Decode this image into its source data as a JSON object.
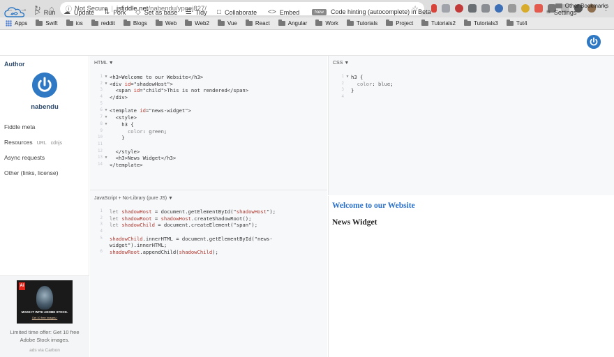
{
  "browser": {
    "security_label": "Not Secure",
    "url_host": "jsfiddle.net",
    "url_path": "/nabendu/ypgej827/",
    "bookmarks": [
      "Apps",
      "Swift",
      "ios",
      "reddit",
      "Blogs",
      "Web",
      "Web2",
      "Vue",
      "React",
      "Angular",
      "Work",
      "Tutorials",
      "Project",
      "Tutorials2",
      "Tutorials3",
      "Tut4"
    ],
    "other_bookmarks": "Other Bookmarks"
  },
  "toolbar": {
    "run": "Run",
    "update": "Update",
    "fork": "Fork",
    "set_as_base": "Set as base",
    "tidy": "Tidy",
    "collaborate": "Collaborate",
    "embed": "Embed",
    "new_badge": "New",
    "code_hinting": "Code hinting (autocomplete) in Beta",
    "settings": "Settings"
  },
  "sidebar": {
    "author_heading": "Author",
    "author_name": "nabendu",
    "fiddle_meta": "Fiddle meta",
    "resources": "Resources",
    "resources_url": "URL",
    "resources_cdnjs": "cdnjs",
    "async_requests": "Async requests",
    "other": "Other (links, license)",
    "ad": {
      "brand": "Ai",
      "image_title": "MAKE IT WITH ADOBE STOCK.",
      "image_subtitle": "Get 10 free images ›",
      "text": "Limited time offer: Get 10 free Adobe Stock images.",
      "via": "ads via Carbon"
    }
  },
  "panels": {
    "html_label": "HTML ▼",
    "css_label": "CSS ▼",
    "js_label": "JavaScript + No-Library (pure JS) ▼"
  },
  "html_code": [
    {
      "n": "1",
      "fold": "▼",
      "t": "<h3>Welcome to our Website</h3>"
    },
    {
      "n": "2",
      "fold": "▼",
      "t": "<div id=\"shadowHost\">"
    },
    {
      "n": "3",
      "fold": "",
      "t": "  <span id=\"child\">This is not rendered</span>"
    },
    {
      "n": "4",
      "fold": "",
      "t": "</div>"
    },
    {
      "n": "5",
      "fold": "",
      "t": ""
    },
    {
      "n": "6",
      "fold": "▼",
      "t": "<template id=\"news-widget\">"
    },
    {
      "n": "7",
      "fold": "▼",
      "t": "  <style>"
    },
    {
      "n": "8",
      "fold": "▼",
      "t": "    h3 {"
    },
    {
      "n": "9",
      "fold": "",
      "t": "      color: green;"
    },
    {
      "n": "10",
      "fold": "",
      "t": "    }"
    },
    {
      "n": "11",
      "fold": "",
      "t": ""
    },
    {
      "n": "12",
      "fold": "",
      "t": "  </style>"
    },
    {
      "n": "13",
      "fold": "▼",
      "t": "  <h3>News Widget</h3>"
    },
    {
      "n": "14",
      "fold": "",
      "t": "</template>"
    }
  ],
  "css_code": [
    {
      "n": "1",
      "fold": "▼",
      "t": "h3 {"
    },
    {
      "n": "2",
      "fold": "",
      "t": "  color: blue;"
    },
    {
      "n": "3",
      "fold": "",
      "t": "}"
    },
    {
      "n": "4",
      "fold": "",
      "t": ""
    }
  ],
  "js_code": [
    {
      "n": "1",
      "t": "let shadowHost = document.getElementById(\"shadowHost\");"
    },
    {
      "n": "2",
      "t": "let shadowRoot = shadowHost.createShadowRoot();"
    },
    {
      "n": "3",
      "t": "let shadowChild = document.createElement(\"span\");"
    },
    {
      "n": "4",
      "t": ""
    },
    {
      "n": "5",
      "t": "shadowChild.innerHTML = document.getElementById(\"news-"
    },
    {
      "n": "",
      "t": "widget\").innerHTML;"
    },
    {
      "n": "6",
      "t": "shadowRoot.appendChild(shadowChild);"
    }
  ],
  "result": {
    "heading1": "Welcome to our Website",
    "heading1_color": "#2a6fc9",
    "heading2": "News Widget",
    "heading2_color": "#222222"
  },
  "colors": {
    "accent": "#2f78c4",
    "panel_bg": "#f7f8fa"
  }
}
